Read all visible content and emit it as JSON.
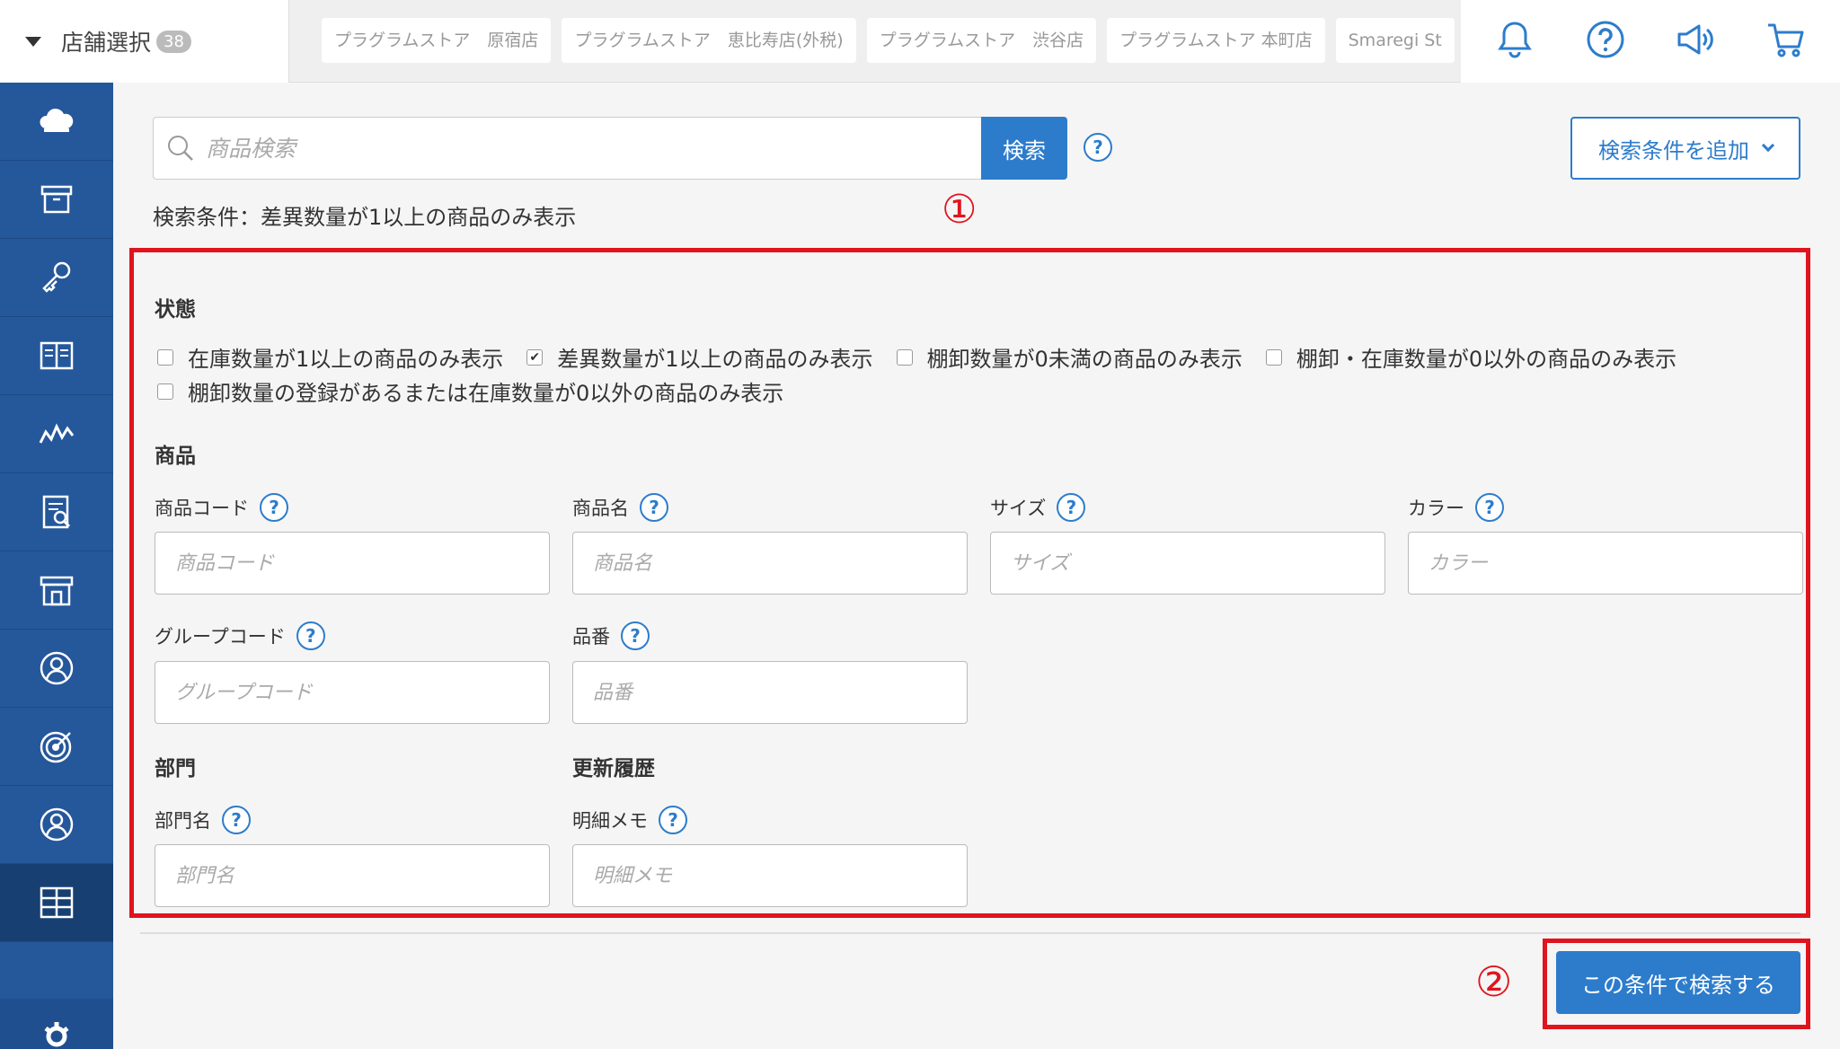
{
  "topbar": {
    "store_select_label": "店舗選択",
    "store_count": "38",
    "store_tabs": [
      "プラグラムストア　原宿店",
      "プラグラムストア　恵比寿店(外税)",
      "プラグラムストア　渋谷店",
      "プラグラムストア 本町店",
      "Smaregi St"
    ],
    "icons": [
      "bell-icon",
      "help-circle-icon",
      "megaphone-icon",
      "cart-icon"
    ]
  },
  "sidebar": {
    "items": [
      "cloud-icon",
      "box-icon",
      "key-icon",
      "book-icon",
      "chart-icon",
      "report-icon",
      "store-icon",
      "user-icon",
      "target-icon",
      "person-icon",
      "grid-icon"
    ],
    "active_index": 10,
    "bottom_icon": "gear-icon"
  },
  "search": {
    "placeholder": "商品検索",
    "button_label": "検索",
    "help": "?",
    "add_condition_label": "検索条件を追加",
    "condition_text": "検索条件：差異数量が1以上の商品のみ表示"
  },
  "markers": {
    "one": "①",
    "two": "②"
  },
  "filters": {
    "status": {
      "title": "状態",
      "options": [
        {
          "label": "在庫数量が1以上の商品のみ表示",
          "checked": false
        },
        {
          "label": "差異数量が1以上の商品のみ表示",
          "checked": true
        },
        {
          "label": "棚卸数量が0未満の商品のみ表示",
          "checked": false
        },
        {
          "label": "棚卸・在庫数量が0以外の商品のみ表示",
          "checked": false
        },
        {
          "label": "棚卸数量の登録があるまたは在庫数量が0以外の商品のみ表示",
          "checked": false
        }
      ]
    },
    "product": {
      "title": "商品",
      "fields": [
        {
          "label": "商品コード",
          "placeholder": "商品コード"
        },
        {
          "label": "商品名",
          "placeholder": "商品名"
        },
        {
          "label": "サイズ",
          "placeholder": "サイズ"
        },
        {
          "label": "カラー",
          "placeholder": "カラー"
        },
        {
          "label": "グループコード",
          "placeholder": "グループコード"
        },
        {
          "label": "品番",
          "placeholder": "品番"
        }
      ]
    },
    "department": {
      "title": "部門",
      "field": {
        "label": "部門名",
        "placeholder": "部門名"
      }
    },
    "history": {
      "title": "更新履歴",
      "field": {
        "label": "明細メモ",
        "placeholder": "明細メモ"
      }
    }
  },
  "submit_label": "この条件で検索する",
  "colors": {
    "accent": "#2d7ccc",
    "sidebar": "#25579b",
    "highlight": "#e0141e"
  }
}
